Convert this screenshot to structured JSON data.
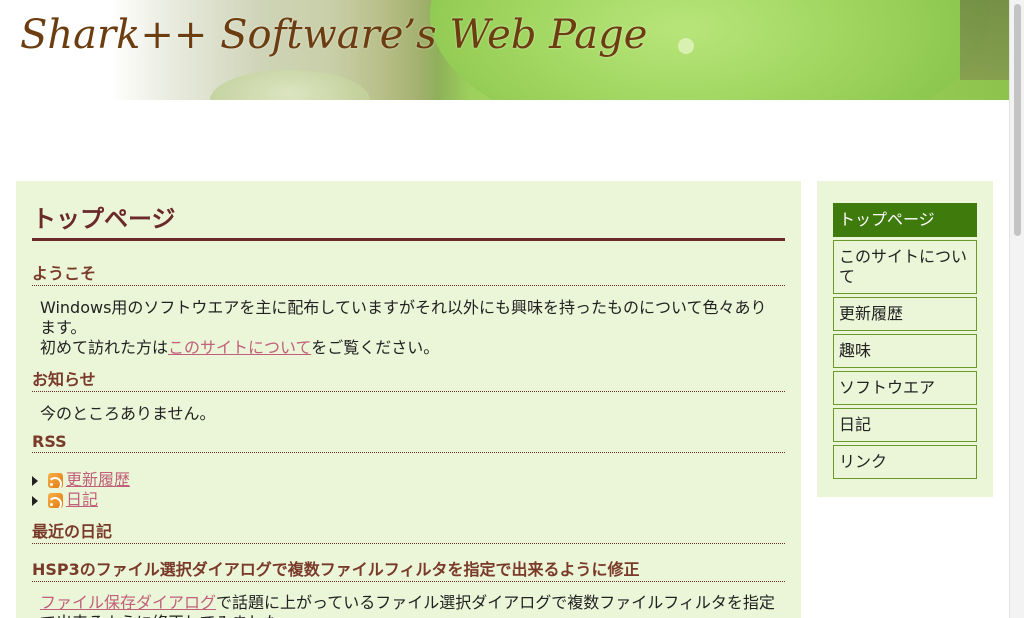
{
  "header": {
    "title": "Shark++ Software’s Web Page"
  },
  "main": {
    "page_title": "トップページ",
    "welcome_heading": "ようこそ",
    "welcome_text_1": "Windows用のソフトウエアを主に配布していますがそれ以外にも興味を持ったものについて色々あります。",
    "welcome_text_2a": "初めて訪れた方は",
    "welcome_link": "このサイトについて",
    "welcome_text_2b": "をご覧ください。",
    "news_heading": "お知らせ",
    "news_text": "今のところありません。",
    "rss_heading": "RSS",
    "rss_items": [
      {
        "label": "更新履歴",
        "icon": "rss-feed-icon"
      },
      {
        "label": "日記",
        "icon": "rss-feed-icon"
      }
    ],
    "diary_heading": "最近の日記",
    "diary_entry_title": "HSP3のファイル選択ダイアログで複数ファイルフィルタを指定で出来るように修正",
    "diary_entry_link": "ファイル保存ダイアログ",
    "diary_entry_text": "で話題に上がっているファイル選択ダイアログで複数ファイルフィルタを指定で出来るように修正してみました。"
  },
  "sidebar": {
    "items": [
      {
        "label": "トップページ",
        "active": true
      },
      {
        "label": "このサイトについて"
      },
      {
        "label": "更新履歴"
      },
      {
        "label": "趣味"
      },
      {
        "label": "ソフトウエア"
      },
      {
        "label": "日記"
      },
      {
        "label": "リンク"
      }
    ]
  },
  "colors": {
    "accent": "#6b2a2a",
    "content_bg": "#ebf6d8",
    "nav_active": "#3f7a0c",
    "link": "#c0607a"
  }
}
